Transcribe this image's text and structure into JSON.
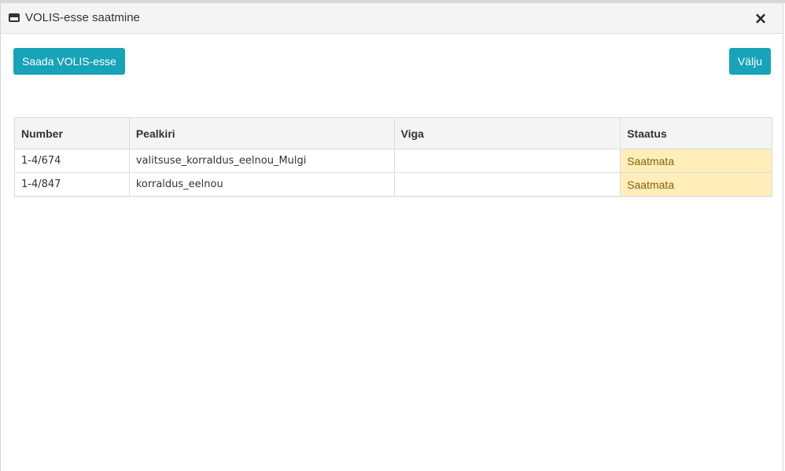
{
  "dialog": {
    "title": "VOLIS-esse saatmine",
    "close_label": "×"
  },
  "toolbar": {
    "send_label": "Saada VOLIS-esse",
    "exit_label": "Välju"
  },
  "table": {
    "columns": [
      "Number",
      "Pealkiri",
      "Viga",
      "Staatus"
    ],
    "rows": [
      {
        "number": "1-4/674",
        "title": "valitsuse_korraldus_eelnou_Mulgi",
        "error": "",
        "status": "Saatmata"
      },
      {
        "number": "1-4/847",
        "title": "korraldus_eelnou",
        "error": "",
        "status": "Saatmata"
      }
    ]
  },
  "colors": {
    "accent": "#17a3b8",
    "status_bg": "#ffeeba",
    "status_text": "#856404"
  }
}
